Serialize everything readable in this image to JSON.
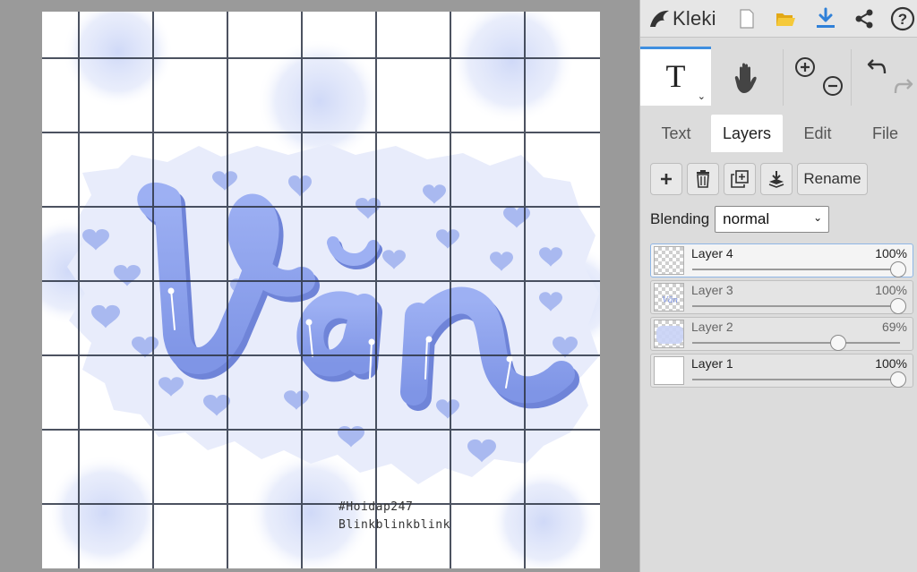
{
  "app": {
    "name": "Kleki"
  },
  "artwork": {
    "lettering": "Văn",
    "caption_line1": "#Hoidap247",
    "caption_line2": "Blinkblinkblink"
  },
  "topbar": {
    "icons": [
      "kleki-logo-icon",
      "new-image-icon",
      "open-folder-icon",
      "download-icon",
      "share-icon",
      "help-icon"
    ]
  },
  "tools": {
    "text_tool_glyph": "T",
    "active_tool": "text",
    "icons": [
      "hand-icon",
      "zoom-in-icon",
      "zoom-out-icon",
      "undo-icon",
      "redo-icon"
    ]
  },
  "tabs": [
    "Text",
    "Layers",
    "Edit",
    "File"
  ],
  "active_tab": "Layers",
  "layers_panel": {
    "rename_label": "Rename",
    "blending_label": "Blending",
    "blending_value": "normal",
    "layers": [
      {
        "name": "Layer 4",
        "opacity": "100%",
        "opacity_value": 1.0,
        "selected": true
      },
      {
        "name": "Layer 3",
        "opacity": "100%",
        "opacity_value": 1.0,
        "selected": false
      },
      {
        "name": "Layer 2",
        "opacity": "69%",
        "opacity_value": 0.69,
        "selected": false
      },
      {
        "name": "Layer 1",
        "opacity": "100%",
        "opacity_value": 1.0,
        "selected": false
      }
    ]
  },
  "colors": {
    "accent": "#3f8fe0",
    "lettering": "#8fa3ee",
    "blob": "#e8ecfb",
    "hearts": "#a9b9f0",
    "grid": "#2d3545",
    "folder": "#f2c335",
    "download": "#2f80d8"
  }
}
